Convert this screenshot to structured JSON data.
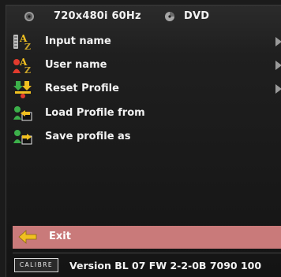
{
  "header": {
    "resolution": "720x480i 60Hz",
    "source": "DVD",
    "disc_icon": "disc-icon",
    "source_icon": "source-disc-icon"
  },
  "menu": {
    "items": [
      {
        "label": "Input name",
        "icon": "az-input-icon",
        "has_submenu": true
      },
      {
        "label": "User name",
        "icon": "az-user-icon",
        "has_submenu": true
      },
      {
        "label": "Reset Profile",
        "icon": "reset-profile-icon",
        "has_submenu": true
      },
      {
        "label": "Load Profile from",
        "icon": "load-profile-icon",
        "has_submenu": false
      },
      {
        "label": "Save profile as",
        "icon": "save-profile-icon",
        "has_submenu": false
      }
    ]
  },
  "exit": {
    "label": "Exit",
    "icon": "exit-arrow-icon"
  },
  "footer": {
    "logo_text": "CALIBRE",
    "version": "Version BL 07 FW 2-2-0B 7090 100"
  },
  "colors": {
    "background": "#1b1b1b",
    "highlight": "#c97a7a",
    "text": "#f2f2f2",
    "icon_yellow": "#f0c020",
    "icon_red": "#e23b2e",
    "icon_green": "#3cb04a"
  }
}
